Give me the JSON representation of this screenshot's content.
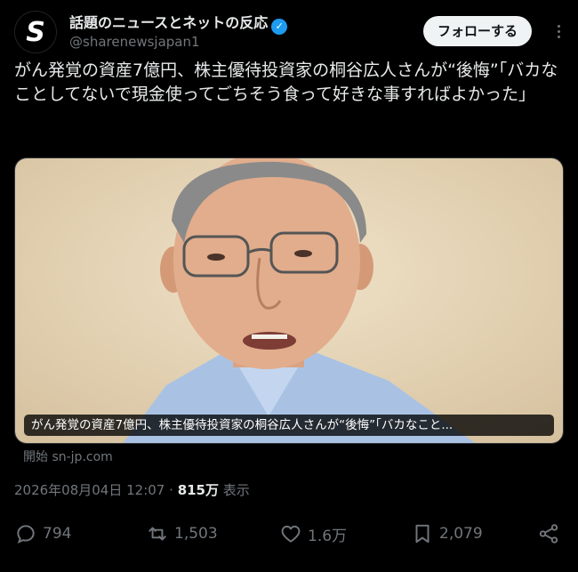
{
  "account": {
    "name": "話題のニュースとネットの反応",
    "handle": "@sharenewsjapan1",
    "avatar_letter": "S",
    "verified_glyph": "✓",
    "follow_label": "フォローする"
  },
  "tweet": {
    "text": "がん発覚の資産7億円、株主優待投資家の桐谷広人さんが“後悔”「バカなことしてないで現金使ってごちそう食って好きな事すればよかった」"
  },
  "card": {
    "caption": "がん発覚の資産7億円、株主優待投資家の桐谷広人さんが“後悔”「バカなこと...",
    "source": "開始 sn-jp.com"
  },
  "meta": {
    "date": "2026年08月04日 12:07",
    "separator": "·",
    "views": "815万",
    "views_label": "表示"
  },
  "actions": {
    "replies": "794",
    "reposts": "1,503",
    "likes": "1.6万",
    "bookmarks": "2,079"
  },
  "colors": {
    "background": "#000000",
    "text": "#e7e9ea",
    "muted": "#71767b",
    "verified": "#1d9bf0",
    "follow_bg": "#eff3f4"
  }
}
